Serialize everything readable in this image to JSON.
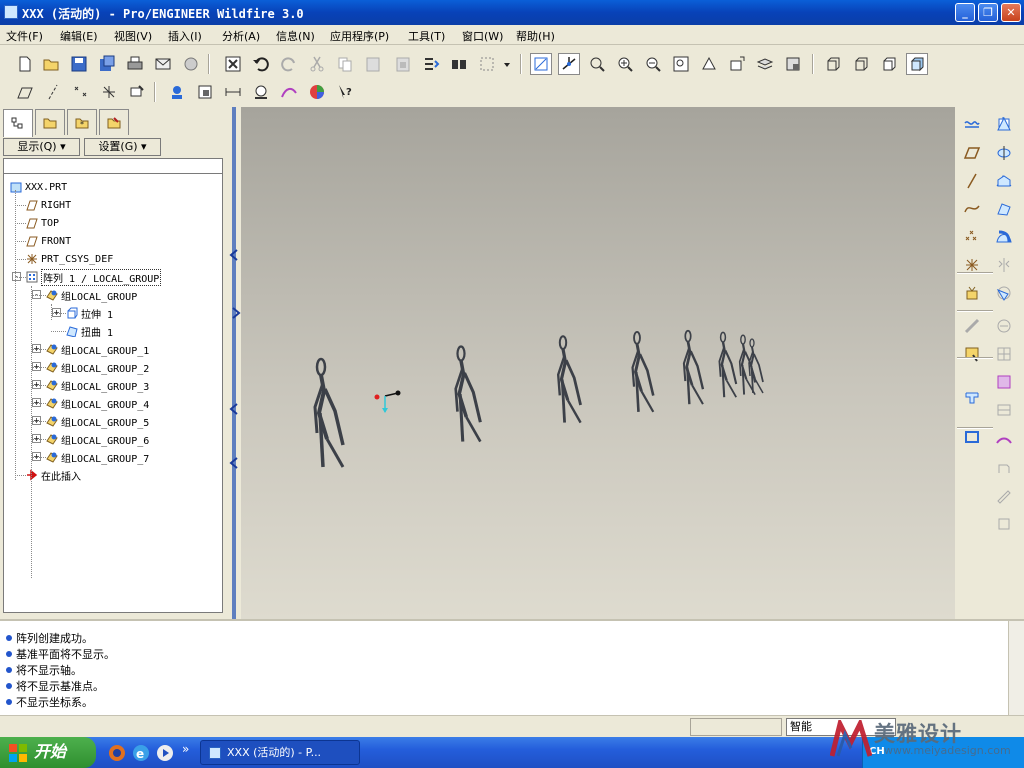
{
  "window": {
    "title": "XXX (活动的) - Pro/ENGINEER Wildfire 3.0",
    "buttons": {
      "minimize": "_",
      "maximize": "❐",
      "close": "✕"
    }
  },
  "menubar": {
    "items": [
      "文件(F)",
      "编辑(E)",
      "视图(V)",
      "插入(I)",
      "分析(A)",
      "信息(N)",
      "应用程序(P)",
      "工具(T)",
      "窗口(W)",
      "帮助(H)"
    ]
  },
  "toolbar": {
    "row1_icons": [
      "new-file-icon",
      "open-folder-icon",
      "save-icon",
      "save-copy-icon",
      "print-icon",
      "email-icon",
      "email-link-icon",
      "close-window-icon",
      "undo-icon",
      "redo-icon",
      "cut-icon",
      "copy-icon",
      "paste-icon",
      "paste-special-icon",
      "regenerate-icon",
      "find-icon",
      "select-box-icon",
      "repaint-icon",
      "spin-center-icon",
      "orient-icon",
      "zoom-in-icon",
      "zoom-out-icon",
      "refit-icon",
      "reorient-icon",
      "saved-views-icon",
      "layers-icon",
      "view-manager-icon",
      "wireframe-icon",
      "hidden-line-icon",
      "no-hidden-icon",
      "shading-icon"
    ],
    "row2_icons": [
      "datum-planes-icon",
      "datum-axes-icon",
      "datum-points-icon",
      "coord-systems-icon",
      "annotation-icon",
      "model-player-icon",
      "named-view-icon",
      "measure-icon",
      "mass-props-icon",
      "curvature-icon",
      "color-appearance-icon",
      "context-help-icon"
    ]
  },
  "left_panel": {
    "tabs": [
      "model-tree-tab",
      "folder-browser-tab",
      "favorites-tab",
      "connections-tab"
    ],
    "show_button": "显示(Q) ▾",
    "settings_button": "设置(G) ▾",
    "tree": [
      {
        "label": "XXX.PRT",
        "icon": "part-icon",
        "level": 0
      },
      {
        "label": "RIGHT",
        "icon": "datum-plane-icon",
        "level": 1
      },
      {
        "label": "TOP",
        "icon": "datum-plane-icon",
        "level": 1
      },
      {
        "label": "FRONT",
        "icon": "datum-plane-icon",
        "level": 1
      },
      {
        "label": "PRT_CSYS_DEF",
        "icon": "csys-icon",
        "level": 1
      },
      {
        "label": "阵列 1 / LOCAL_GROUP",
        "icon": "pattern-icon",
        "level": 1,
        "expander": "-"
      },
      {
        "label": "组LOCAL_GROUP",
        "icon": "group-icon",
        "level": 2,
        "expander": "-"
      },
      {
        "label": "拉伸 1",
        "icon": "extrude-icon",
        "level": 3,
        "expander": "+"
      },
      {
        "label": "扭曲 1",
        "icon": "warp-icon",
        "level": 3
      },
      {
        "label": "组LOCAL_GROUP_1",
        "icon": "group-icon",
        "level": 2,
        "expander": "+"
      },
      {
        "label": "组LOCAL_GROUP_2",
        "icon": "group-icon",
        "level": 2,
        "expander": "+"
      },
      {
        "label": "组LOCAL_GROUP_3",
        "icon": "group-icon",
        "level": 2,
        "expander": "+"
      },
      {
        "label": "组LOCAL_GROUP_4",
        "icon": "group-icon",
        "level": 2,
        "expander": "+"
      },
      {
        "label": "组LOCAL_GROUP_5",
        "icon": "group-icon",
        "level": 2,
        "expander": "+"
      },
      {
        "label": "组LOCAL_GROUP_6",
        "icon": "group-icon",
        "level": 2,
        "expander": "+"
      },
      {
        "label": "组LOCAL_GROUP_7",
        "icon": "group-icon",
        "level": 2,
        "expander": "+"
      },
      {
        "label": "在此插入",
        "icon": "insert-here-icon",
        "level": 1
      }
    ]
  },
  "right_toolbar": {
    "icons": [
      "datum-off-icon",
      "hole-icon",
      "plane-icon",
      "revolve-icon",
      "axis-icon",
      "sweep-icon",
      "curve-icon",
      "blend-icon",
      "point-icon",
      "boundary-icon",
      "csys-tool-icon",
      "mirror-icon",
      "analysis-icon",
      "merge-icon",
      "sketch-tool-icon",
      "trim-icon",
      "sketch-icon",
      "pattern-tool-icon",
      "extrude-tool-icon",
      "offset-icon",
      "shell-icon",
      "thicken-icon",
      "draft-icon",
      "solidify-icon",
      "round-icon",
      "project-icon",
      "chamfer-icon",
      "wrap-icon",
      "rib-icon",
      "style-icon"
    ]
  },
  "messages": [
    "阵列创建成功。",
    "基准平面将不显示。",
    "将不显示轴。",
    "将不显示基准点。",
    "不显示坐标系。"
  ],
  "status": {
    "filter_value": "智能"
  },
  "taskbar": {
    "start_label": "开始",
    "quick_launch_icons": [
      "firefox-icon",
      "ie-icon",
      "media-icon"
    ],
    "chevron": "»",
    "task_item": "XXX (活动的) - P...",
    "tray_lang": "CH"
  },
  "watermark": {
    "brand": "美雅设计",
    "url": "www.meiyadesign.com"
  },
  "colors": {
    "title_blue": "#0842b8",
    "sash_blue": "#5f7fbf",
    "figure": "#3c4048",
    "csys_red": "#e02020",
    "csys_cyan": "#30c8d8"
  }
}
